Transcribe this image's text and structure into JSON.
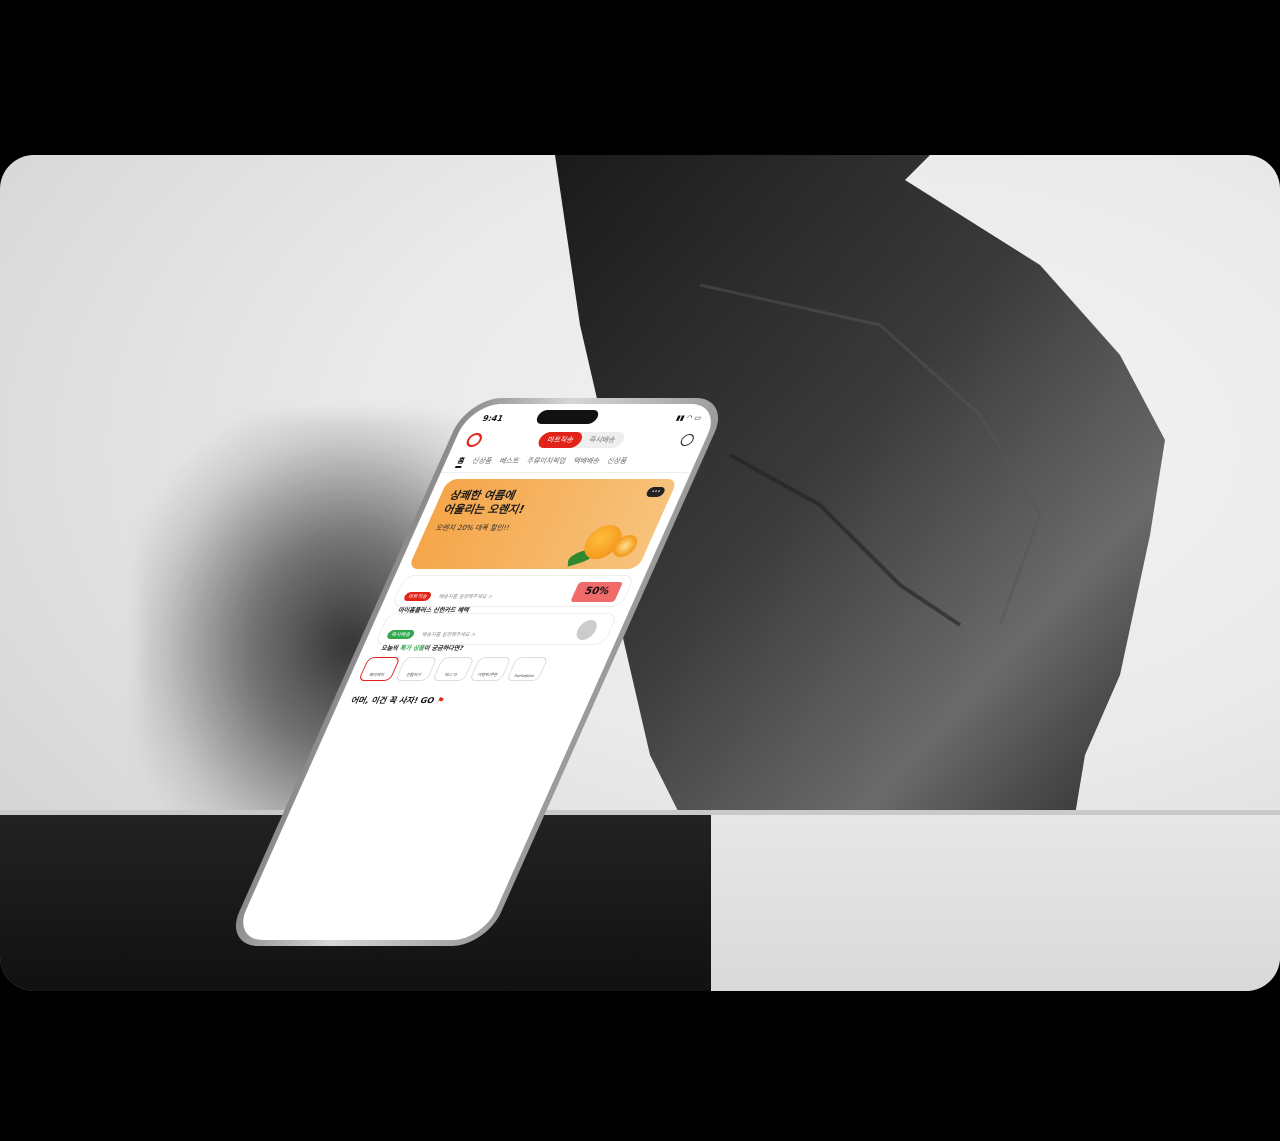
{
  "phone": {
    "status_time": "9:41",
    "delivery_tabs": [
      "마트직송",
      "즉시배송"
    ],
    "category_tabs": [
      "홈",
      "신상품",
      "베스트",
      "주류이지픽업",
      "택배배송",
      "신상품"
    ],
    "banner": {
      "headline_1": "상쾌한 여름에",
      "headline_2": "어울리는 오렌지!",
      "subtext": "오렌지 20% 대폭 할인!!"
    },
    "card_mart": {
      "tag": "마트직송",
      "sub": "배송지를 설정해주세요 >",
      "main": "마이홈플러스 신한카드 혜택",
      "coupon": "50%"
    },
    "card_instant": {
      "tag": "즉시배송",
      "sub": "배송지를 설정해주세요 >",
      "main_prefix": "오늘의",
      "main_highlight": "특가 상품",
      "main_suffix": "이 궁금하다면?"
    },
    "shortcuts": [
      "페이퍼미",
      "선물하기",
      "하나 더",
      "이벤트/쿠폰",
      "homeplus"
    ],
    "section_title": "어머, 이건 꼭 사자! GO"
  }
}
